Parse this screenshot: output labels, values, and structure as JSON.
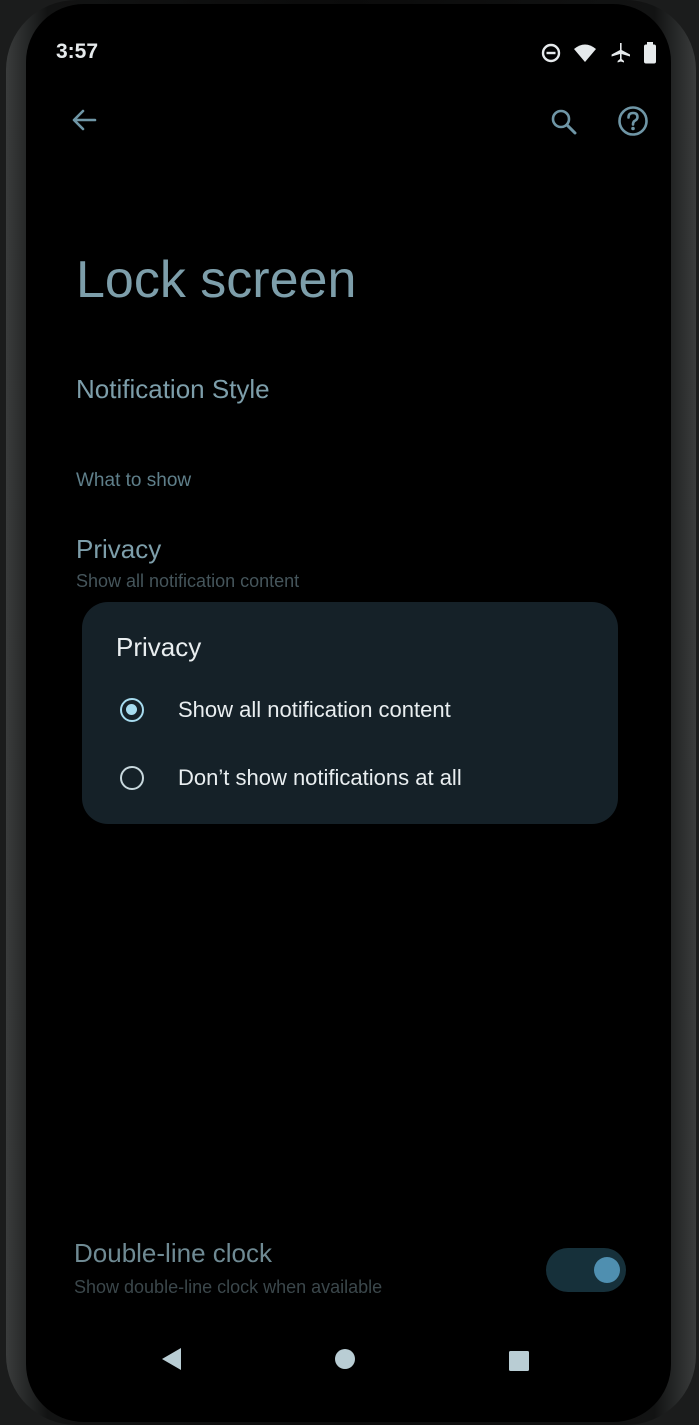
{
  "status_bar": {
    "time": "3:57",
    "icons": [
      "do-not-disturb-icon",
      "wifi-icon",
      "airplane-icon",
      "battery-icon"
    ]
  },
  "top_bar": {
    "icons": [
      "back-arrow-icon",
      "search-icon",
      "help-icon"
    ]
  },
  "page": {
    "title": "Lock screen",
    "notification_style": "Notification Style",
    "section_header": "What to show",
    "privacy": {
      "title": "Privacy",
      "summary": "Show all notification content"
    }
  },
  "dialog": {
    "title": "Privacy",
    "options": [
      {
        "label": "Show all notification content",
        "selected": true
      },
      {
        "label": "Don’t show notifications at all",
        "selected": false
      }
    ]
  },
  "double_line_clock": {
    "title": "Double-line clock",
    "summary": "Show double-line clock when available",
    "enabled": true
  },
  "nav_bar": {
    "icons": [
      "nav-back-icon",
      "nav-home-icon",
      "nav-recents-icon"
    ]
  },
  "colors": {
    "accent": "#a7dcef",
    "dialog_background": "#152128",
    "text_dim": "#7d9eaa"
  }
}
